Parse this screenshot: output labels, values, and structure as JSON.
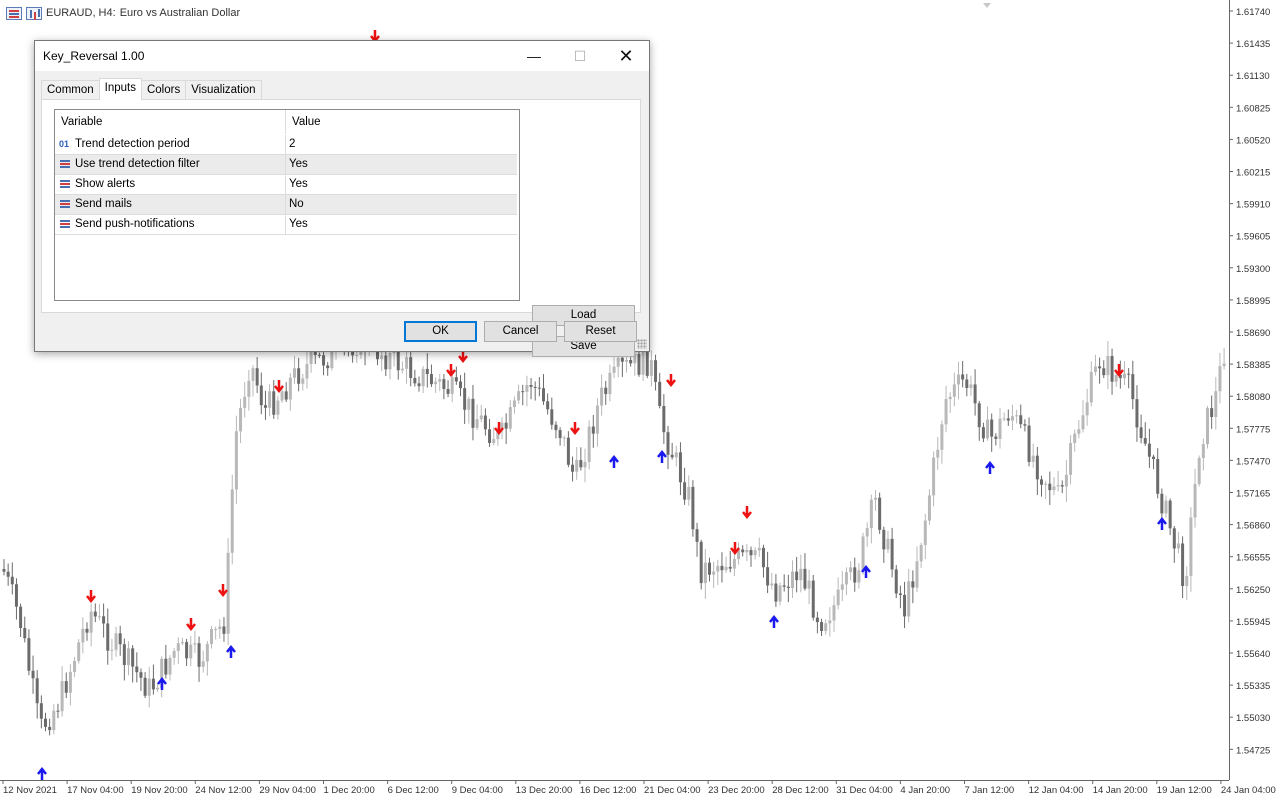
{
  "chart": {
    "symbol_title": "EURAUD, H4:",
    "description": "Euro vs Australian Dollar",
    "price_labels": [
      "1.61740",
      "1.61435",
      "1.61130",
      "1.60825",
      "1.60520",
      "1.60215",
      "1.59910",
      "1.59605",
      "1.59300",
      "1.58995",
      "1.58690",
      "1.58385",
      "1.58080",
      "1.57775",
      "1.57470",
      "1.57165",
      "1.56860",
      "1.56555",
      "1.56250",
      "1.55945",
      "1.55640",
      "1.55335",
      "1.55030",
      "1.54725"
    ],
    "time_labels": [
      "12 Nov 2021",
      "17 Nov 04:00",
      "19 Nov 20:00",
      "24 Nov 12:00",
      "29 Nov 04:00",
      "1 Dec 20:00",
      "6 Dec 12:00",
      "9 Dec 04:00",
      "13 Dec 20:00",
      "16 Dec 12:00",
      "21 Dec 04:00",
      "23 Dec 20:00",
      "28 Dec 12:00",
      "31 Dec 04:00",
      "4 Jan 20:00",
      "7 Jan 12:00",
      "12 Jan 04:00",
      "14 Jan 20:00",
      "19 Jan 12:00",
      "24 Jan 04:00"
    ],
    "colors": {
      "bull": "#b8b8b8",
      "bear": "#6b6b6b",
      "sell_arrow": "#ee1111",
      "buy_arrow": "#1a1aee",
      "grid_text": "#333333"
    }
  },
  "dialog": {
    "title": "Key_Reversal 1.00",
    "window_buttons": {
      "minimize": "—",
      "maximize": "☐",
      "close": "✕"
    },
    "tabs": [
      {
        "label": "Common",
        "active": false
      },
      {
        "label": "Inputs",
        "active": true
      },
      {
        "label": "Colors",
        "active": false
      },
      {
        "label": "Visualization",
        "active": false
      }
    ],
    "grid": {
      "headers": {
        "variable": "Variable",
        "value": "Value"
      },
      "rows": [
        {
          "icon": "int-icon",
          "icon_text": "01",
          "variable": "Trend detection period",
          "value": "2"
        },
        {
          "icon": "bool-icon",
          "icon_text": "",
          "variable": "Use trend detection filter",
          "value": "Yes"
        },
        {
          "icon": "bool-icon",
          "icon_text": "",
          "variable": "Show alerts",
          "value": "Yes"
        },
        {
          "icon": "bool-icon",
          "icon_text": "",
          "variable": "Send mails",
          "value": "No"
        },
        {
          "icon": "bool-icon",
          "icon_text": "",
          "variable": "Send push-notifications",
          "value": "Yes"
        }
      ]
    },
    "buttons": {
      "load": "Load",
      "save": "Save",
      "ok": "OK",
      "cancel": "Cancel",
      "reset": "Reset"
    }
  }
}
